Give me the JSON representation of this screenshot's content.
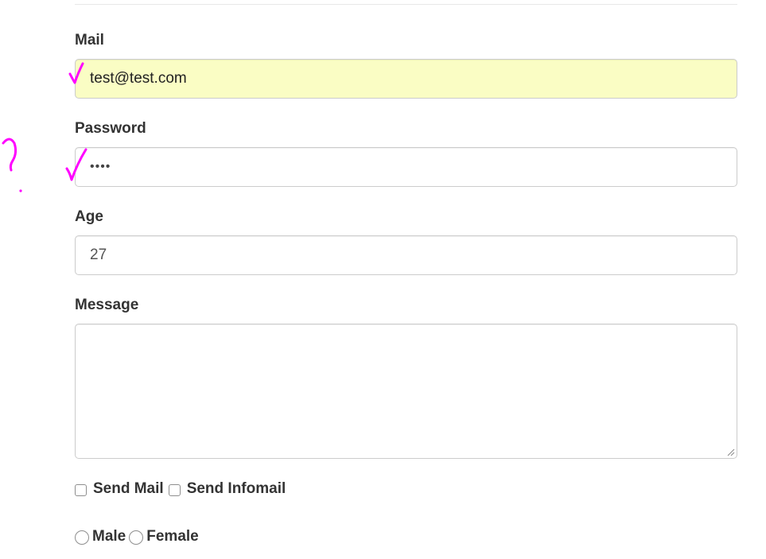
{
  "form": {
    "mail": {
      "label": "Mail",
      "value": "test@test.com"
    },
    "password": {
      "label": "Password",
      "value": "••••"
    },
    "age": {
      "label": "Age",
      "value": "27"
    },
    "message": {
      "label": "Message",
      "value": ""
    },
    "checkboxes": [
      {
        "label": "Send Mail",
        "checked": false
      },
      {
        "label": "Send Infomail",
        "checked": false
      }
    ],
    "radios": [
      {
        "label": "Male",
        "selected": false
      },
      {
        "label": "Female",
        "selected": false
      }
    ]
  },
  "annotations": {
    "color": "#ff00ff",
    "marks": [
      "checkmark",
      "checkmark",
      "question-mark"
    ]
  },
  "colors": {
    "autofill_background": "#fafdc4",
    "border": "#cccccc",
    "label_text": "#333333"
  }
}
